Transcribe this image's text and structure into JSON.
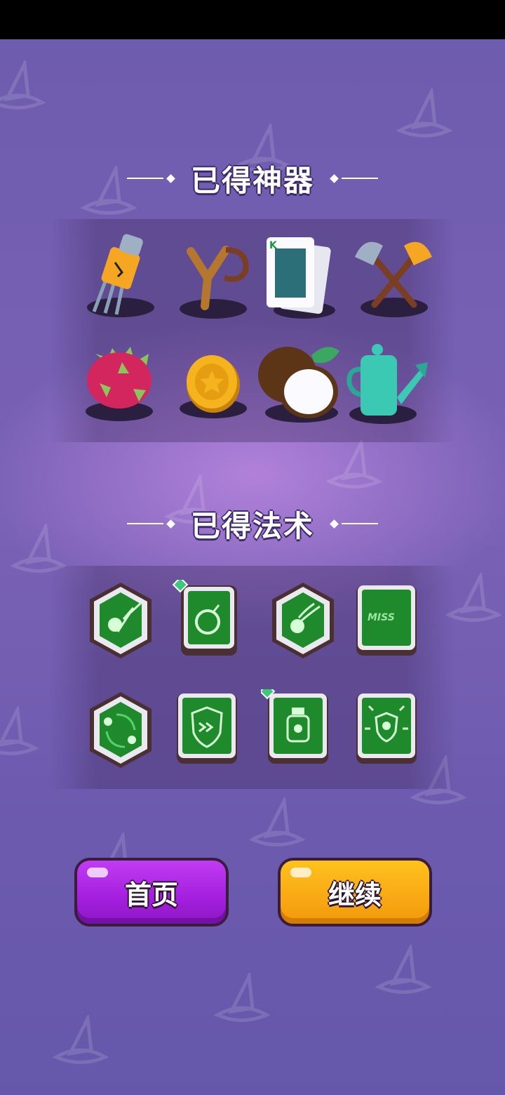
{
  "artifacts_section": {
    "title": "已得神器",
    "items": [
      {
        "name": "fork-icon"
      },
      {
        "name": "slingshot-icon"
      },
      {
        "name": "playing-card-icon"
      },
      {
        "name": "crossed-axes-icon"
      },
      {
        "name": "dragon-fruit-icon"
      },
      {
        "name": "gold-coin-icon"
      },
      {
        "name": "coconut-icon"
      },
      {
        "name": "watering-can-icon"
      }
    ]
  },
  "spells_section": {
    "title": "已得法术",
    "items": [
      {
        "name": "skull-bounce-spell-icon",
        "shape": "hexagon",
        "has_gem": false
      },
      {
        "name": "bomb-spell-icon",
        "shape": "square",
        "has_gem": true
      },
      {
        "name": "comet-spell-icon",
        "shape": "hexagon",
        "has_gem": false
      },
      {
        "name": "miss-spell-icon",
        "shape": "square",
        "has_gem": false,
        "text": "MISS"
      },
      {
        "name": "orbit-spell-icon",
        "shape": "hexagon",
        "has_gem": false
      },
      {
        "name": "shield-speed-spell-icon",
        "shape": "square",
        "has_gem": false
      },
      {
        "name": "poison-bottle-spell-icon",
        "shape": "square",
        "has_gem": true
      },
      {
        "name": "skull-shield-spell-icon",
        "shape": "square",
        "has_gem": false
      }
    ]
  },
  "buttons": {
    "home_label": "首页",
    "continue_label": "继续"
  },
  "colors": {
    "background": "#6a57a8",
    "home_button": "#a31fde",
    "continue_button": "#f8a814",
    "spell_green": "#1f8a2c"
  }
}
